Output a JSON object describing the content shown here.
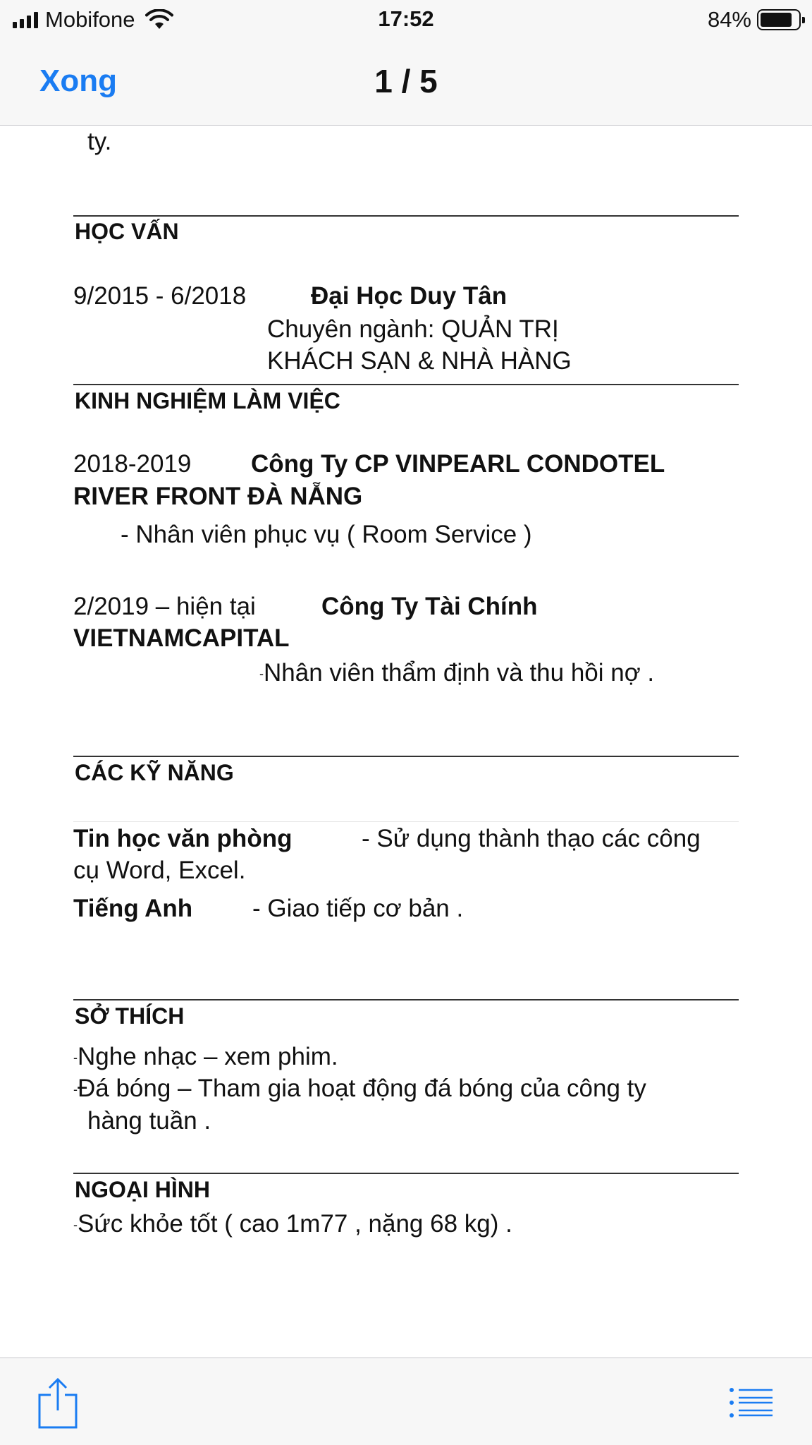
{
  "status_bar": {
    "carrier": "Mobifone",
    "time": "17:52",
    "battery_percent": "84%",
    "battery_level": 0.84
  },
  "nav": {
    "done_label": "Xong",
    "page_indicator": "1 / 5"
  },
  "document": {
    "top_fragment": "ty.",
    "education": {
      "heading": "HỌC VẤN",
      "period": "9/2015 - 6/2018",
      "school": "Đại Học Duy Tân",
      "major_line1": "Chuyên ngành: QUẢN TRỊ",
      "major_line2": "KHÁCH SẠN & NHÀ HÀNG"
    },
    "experience": {
      "heading": "KINH NGHIỆM LÀM VIỆC",
      "jobs": [
        {
          "period": "2018-2019",
          "company_line1": "Công Ty CP VINPEARL CONDOTEL",
          "company_line2": "RIVER FRONT ĐÀ NẴNG",
          "role": "- Nhân viên phục vụ ( Room Service )"
        },
        {
          "period": "2/2019 – hiện tại",
          "company_line1": "Công Ty Tài Chính",
          "company_line2": "VIETNAMCAPITAL",
          "role": "Nhân viên thẩm định và thu hồi nợ ."
        }
      ]
    },
    "skills": {
      "heading": "CÁC KỸ NĂNG",
      "items": [
        {
          "name": "Tin học văn phòng",
          "desc_line1": "- Sử dụng thành thạo các công",
          "desc_line2": "cụ Word, Excel."
        },
        {
          "name": "Tiếng Anh",
          "desc_line1": "- Giao tiếp cơ bản ."
        }
      ]
    },
    "hobbies": {
      "heading": "SỞ THÍCH",
      "item1": "Nghe nhạc – xem phim.",
      "item2_line1": "Đá bóng – Tham gia hoạt động đá bóng của công ty",
      "item2_line2": "hàng tuần ."
    },
    "appearance": {
      "heading": "NGOẠI HÌNH",
      "item1": "Sức khỏe  tốt ( cao 1m77 , nặng 68 kg) ."
    }
  },
  "toolbar": {
    "share_icon": "share-icon",
    "outline_icon": "list-icon"
  },
  "colors": {
    "accent": "#1a7cf2",
    "bar_background": "#f7f7f7"
  }
}
